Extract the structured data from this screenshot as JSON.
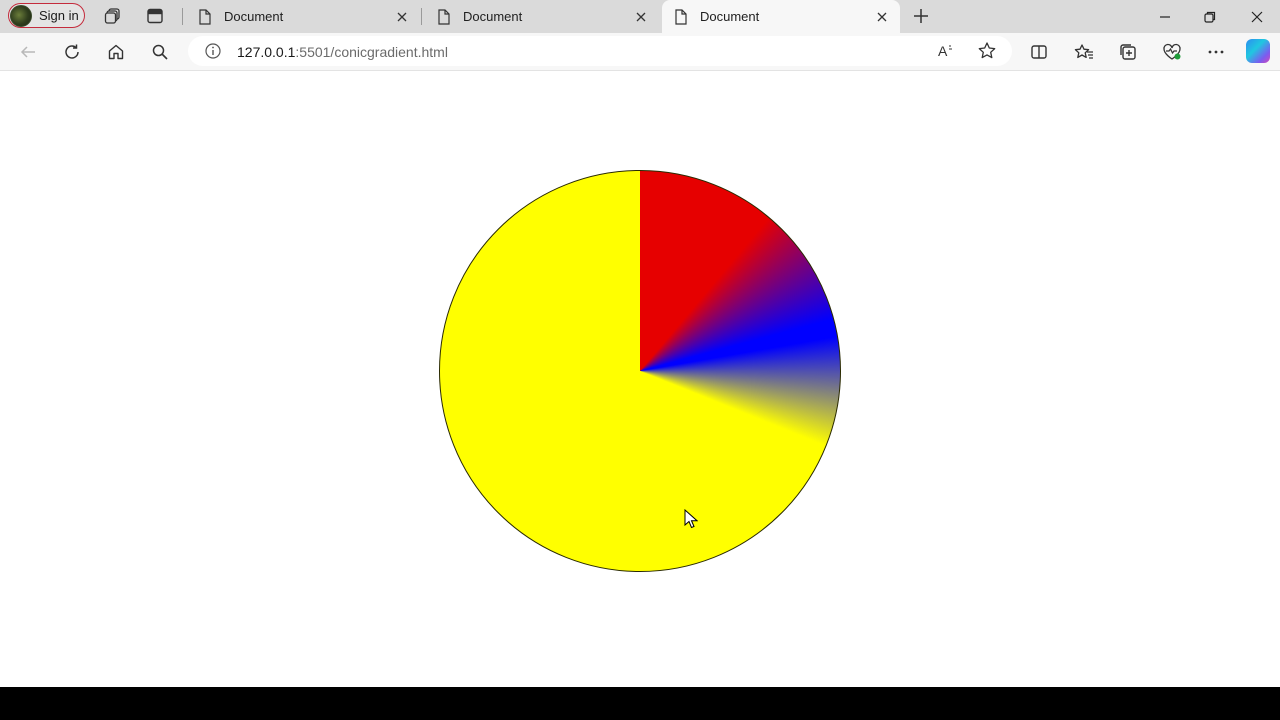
{
  "browser": {
    "signin_label": "Sign in",
    "tabs": [
      {
        "title": "Document",
        "active": false
      },
      {
        "title": "Document",
        "active": false
      },
      {
        "title": "Document",
        "active": true
      }
    ],
    "url_host": "127.0.0.1",
    "url_path": ":5501/conicgradient.html"
  },
  "page": {
    "conic_gradient": {
      "from_deg": 0,
      "stops": [
        {
          "color": "#e60000",
          "deg": 0
        },
        {
          "color": "#e60000",
          "deg": 40
        },
        {
          "color": "#0000ff",
          "deg": 75
        },
        {
          "color": "#0000ff",
          "deg": 80
        },
        {
          "color": "#ffff00",
          "deg": 112
        },
        {
          "color": "#ffff00",
          "deg": 360
        }
      ]
    }
  }
}
